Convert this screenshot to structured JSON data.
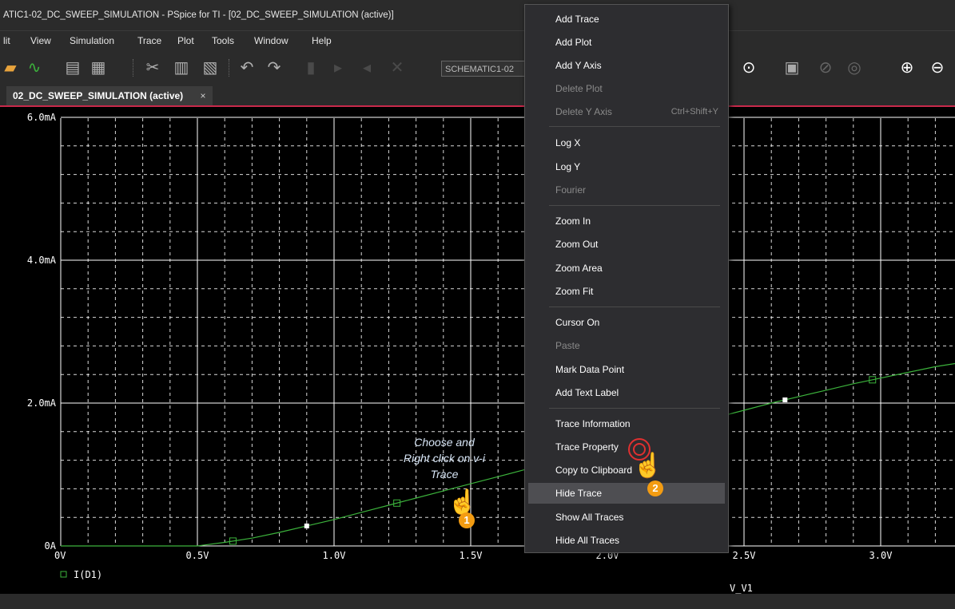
{
  "window": {
    "title": "ATIC1-02_DC_SWEEP_SIMULATION - PSpice for TI - [02_DC_SWEEP_SIMULATION (active)]"
  },
  "menu": [
    "lit",
    "View",
    "Simulation",
    "Trace",
    "Plot",
    "Tools",
    "Window",
    "Help"
  ],
  "toolbar": {
    "combo_value": "SCHEMATIC1-02"
  },
  "tab": {
    "label": "02_DC_SWEEP_SIMULATION (active)",
    "close": "×"
  },
  "plot": {
    "y_tick_labels": [
      "6.0mA",
      "4.0mA",
      "2.0mA",
      "0A"
    ],
    "x_tick_labels": [
      "0V",
      "0.5V",
      "1.0V",
      "1.5V",
      "2.0V",
      "2.5V",
      "3.0V"
    ],
    "x_axis_label": "V_V1",
    "legend": "I(D1)",
    "colors": {
      "trace": "#3cb33c",
      "grid": "#ffffff",
      "background": "#000000"
    }
  },
  "chart_data": {
    "type": "line",
    "xlabel": "V_V1",
    "ylabel": "",
    "xlim": [
      0,
      3.3
    ],
    "ylim": [
      0,
      6
    ],
    "y_unit": "mA",
    "series": [
      {
        "name": "I(D1)",
        "x": [
          0,
          0.5,
          0.6,
          0.7,
          0.8,
          0.9,
          1.0,
          1.1,
          1.2,
          1.3,
          1.4,
          1.5,
          1.6,
          1.7,
          1.8,
          1.9,
          2.0,
          2.1,
          2.2,
          2.3,
          2.4,
          2.5,
          2.6,
          2.7,
          2.8,
          2.9,
          3.0,
          3.1,
          3.2,
          3.3
        ],
        "y": [
          0,
          0,
          0.05,
          0.11,
          0.19,
          0.28,
          0.37,
          0.47,
          0.57,
          0.67,
          0.77,
          0.87,
          0.97,
          1.07,
          1.17,
          1.28,
          1.38,
          1.49,
          1.6,
          1.7,
          1.8,
          1.9,
          2.0,
          2.09,
          2.18,
          2.27,
          2.35,
          2.43,
          2.51,
          2.57
        ]
      }
    ],
    "markers_x": [
      0.63,
      1.23,
      2.97
    ],
    "data_points_x": [
      0.9,
      2.65
    ]
  },
  "context_menu": {
    "items": [
      {
        "label": "Add Trace",
        "enabled": true
      },
      {
        "label": "Add Plot",
        "enabled": true
      },
      {
        "label": "Add Y Axis",
        "enabled": true
      },
      {
        "label": "Delete Plot",
        "enabled": false
      },
      {
        "label": "Delete Y Axis",
        "shortcut": "Ctrl+Shift+Y",
        "enabled": false
      },
      {
        "label": "Log X",
        "enabled": true
      },
      {
        "label": "Log Y",
        "enabled": true
      },
      {
        "label": "Fourier",
        "enabled": false
      },
      {
        "label": "Zoom In",
        "enabled": true
      },
      {
        "label": "Zoom Out",
        "enabled": true
      },
      {
        "label": "Zoom Area",
        "enabled": true
      },
      {
        "label": "Zoom Fit",
        "enabled": true
      },
      {
        "label": "Cursor On",
        "enabled": true
      },
      {
        "label": "Paste",
        "enabled": false
      },
      {
        "label": "Mark Data Point",
        "enabled": true
      },
      {
        "label": "Add Text Label",
        "enabled": true
      },
      {
        "label": "Trace Information",
        "enabled": true
      },
      {
        "label": "Trace Property",
        "enabled": true
      },
      {
        "label": "Copy to Clipboard",
        "enabled": true
      },
      {
        "label": "Hide Trace",
        "enabled": true,
        "highlighted": true
      },
      {
        "label": "Show All Traces",
        "enabled": true
      },
      {
        "label": "Hide All Traces",
        "enabled": true
      }
    ]
  },
  "annotation": {
    "line1": "Choose and",
    "line2": "Right click on v-i",
    "line3": "Trace",
    "step1": "1",
    "step2": "2"
  }
}
